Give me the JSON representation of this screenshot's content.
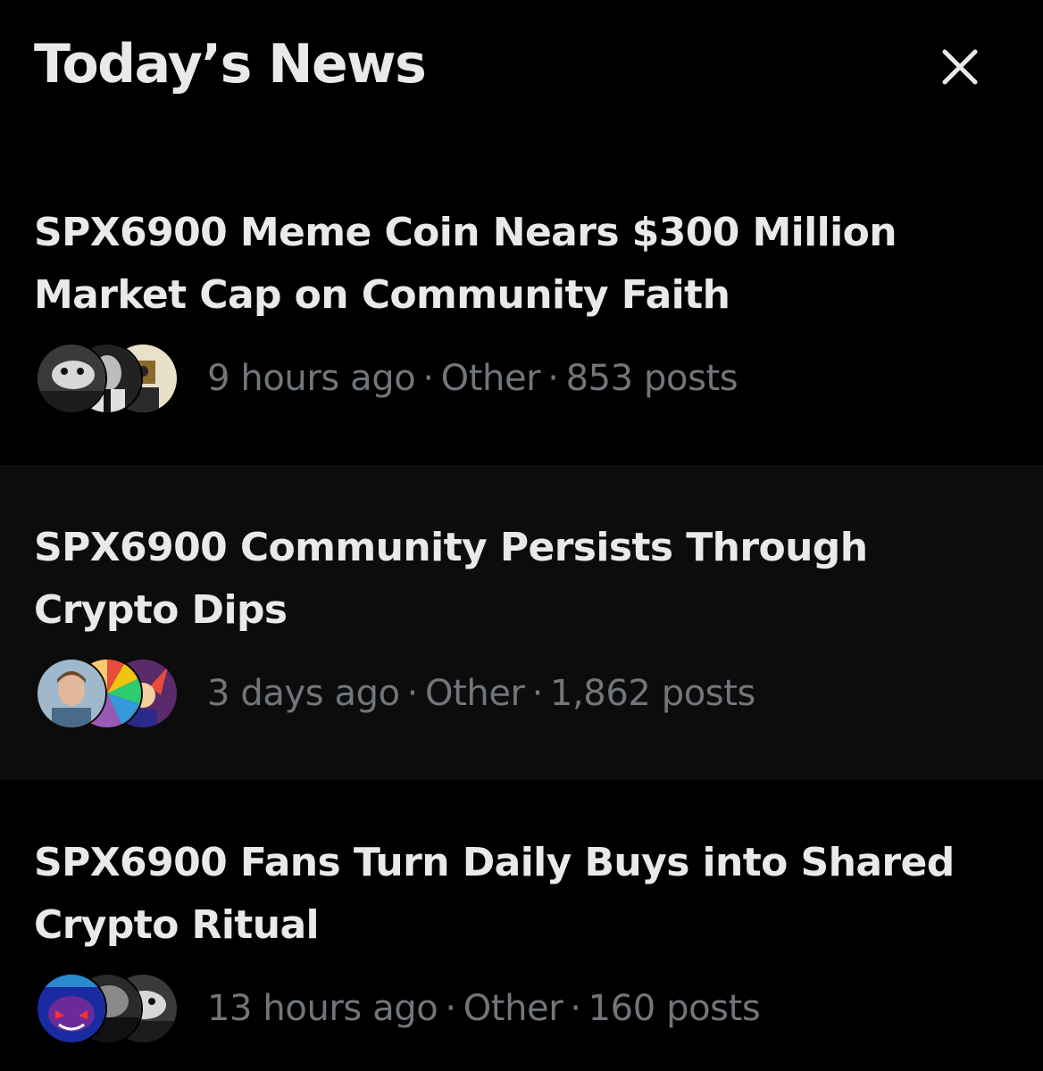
{
  "panel": {
    "title": "Today’s News",
    "close_icon": "close-icon"
  },
  "colors": {
    "background": "#000000",
    "highlight_background": "#0c0c0d",
    "headline_text": "#e7e9ea",
    "meta_text": "#71767b"
  },
  "stories": [
    {
      "headline": "SPX6900 Meme Coin Nears $300 Million Market Cap on Community Faith",
      "time": "9 hours ago",
      "category": "Other",
      "posts": "853 posts",
      "separator": "·"
    },
    {
      "headline": "SPX6900 Community Persists Through Crypto Dips",
      "time": "3 days ago",
      "category": "Other",
      "posts": "1,862 posts",
      "separator": "·"
    },
    {
      "headline": "SPX6900 Fans Turn Daily Buys into Shared Crypto Ritual",
      "time": "13 hours ago",
      "category": "Other",
      "posts": "160 posts",
      "separator": "·"
    }
  ]
}
